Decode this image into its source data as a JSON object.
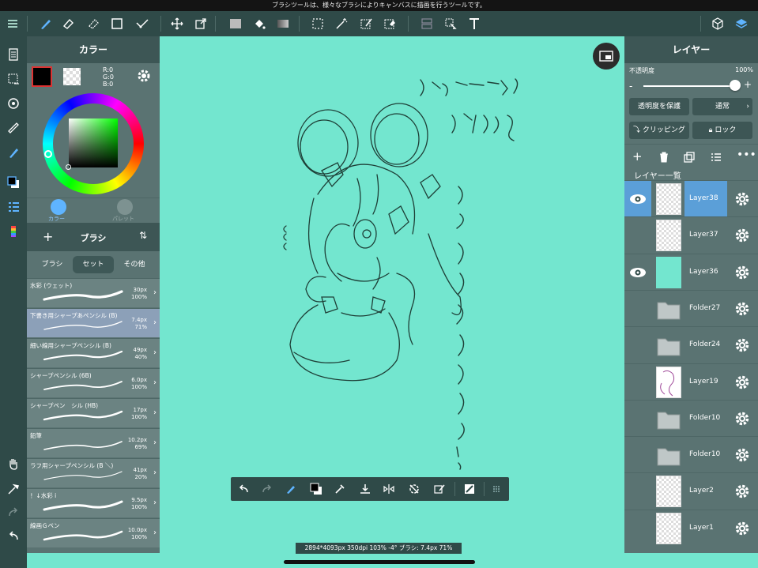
{
  "status_bar": {
    "message": "ブラシツールは、様々なブラシによりキャンバスに描画を行うツールです。"
  },
  "color_panel": {
    "title": "カラー",
    "rgb": {
      "r": "R:0",
      "g": "G:0",
      "b": "B:0"
    },
    "tabs": {
      "color": "カラー",
      "palette": "パレット"
    }
  },
  "brush_panel": {
    "title": "ブラシ",
    "tabs": [
      "ブラシ",
      "セット",
      "その他"
    ],
    "selected_tab": "セット",
    "brushes": [
      {
        "name": "水彩 (ウェット)",
        "size": "30px",
        "opacity": "100%"
      },
      {
        "name": "下書き用シャープあペンシル (B)",
        "size": "7.4px",
        "opacity": "71%",
        "selected": true
      },
      {
        "name": "細い線用シャープペンシル (B)",
        "size": "49px",
        "opacity": "40%"
      },
      {
        "name": "シャープペンシル (6B)",
        "size": "6.0px",
        "opacity": "100%"
      },
      {
        "name": "シャープペン　シル (HB)",
        "size": "17px",
        "opacity": "100%"
      },
      {
        "name": "鉛筆",
        "size": "10.2px",
        "opacity": "69%"
      },
      {
        "name": "ラフ用シャープペンシル (B ＼)",
        "size": "41px",
        "opacity": "20%"
      },
      {
        "name": "！↓水彩 i",
        "size": "9.5px",
        "opacity": "100%"
      },
      {
        "name": "線画Ｇペン",
        "size": "10.0px",
        "opacity": "100%"
      }
    ]
  },
  "canvas": {
    "background": "#73e6cf",
    "handwriting": [
      "ヴォジャニーツァ",
      "イイよね",
      "なんで私に着せるんですか?!"
    ],
    "info": "2894*4093px 350dpi 103% -4° ブラシ: 7.4px 71%"
  },
  "layer_panel": {
    "title": "レイヤー",
    "opacity_label": "不透明度",
    "opacity_value": "100%",
    "opacity": 1.0,
    "protect_alpha": "透明度を保護",
    "blend_mode": "通常",
    "clipping": "クリッピング",
    "lock": "ロック",
    "list_label": "レイヤー一覧",
    "layers": [
      {
        "name": "Layer38",
        "visible": true,
        "selected": true,
        "thumb": "empty"
      },
      {
        "name": "Layer37",
        "visible": false,
        "thumb": "empty"
      },
      {
        "name": "Layer36",
        "visible": true,
        "thumb": "teal"
      },
      {
        "name": "Folder27",
        "visible": false,
        "thumb": "folder"
      },
      {
        "name": "Folder24",
        "visible": false,
        "thumb": "folder"
      },
      {
        "name": "Layer19",
        "visible": false,
        "thumb": "sketch"
      },
      {
        "name": "Folder10",
        "visible": false,
        "thumb": "folder"
      },
      {
        "name": "Folder10",
        "visible": false,
        "thumb": "folder"
      },
      {
        "name": "Layer2",
        "visible": false,
        "thumb": "empty"
      },
      {
        "name": "Layer1",
        "visible": false,
        "thumb": "empty"
      }
    ]
  },
  "colors": {
    "toolbar": "#2f4a48",
    "panel": "#5a7372",
    "accent": "#5b9fd8",
    "canvas": "#73e6cf"
  }
}
